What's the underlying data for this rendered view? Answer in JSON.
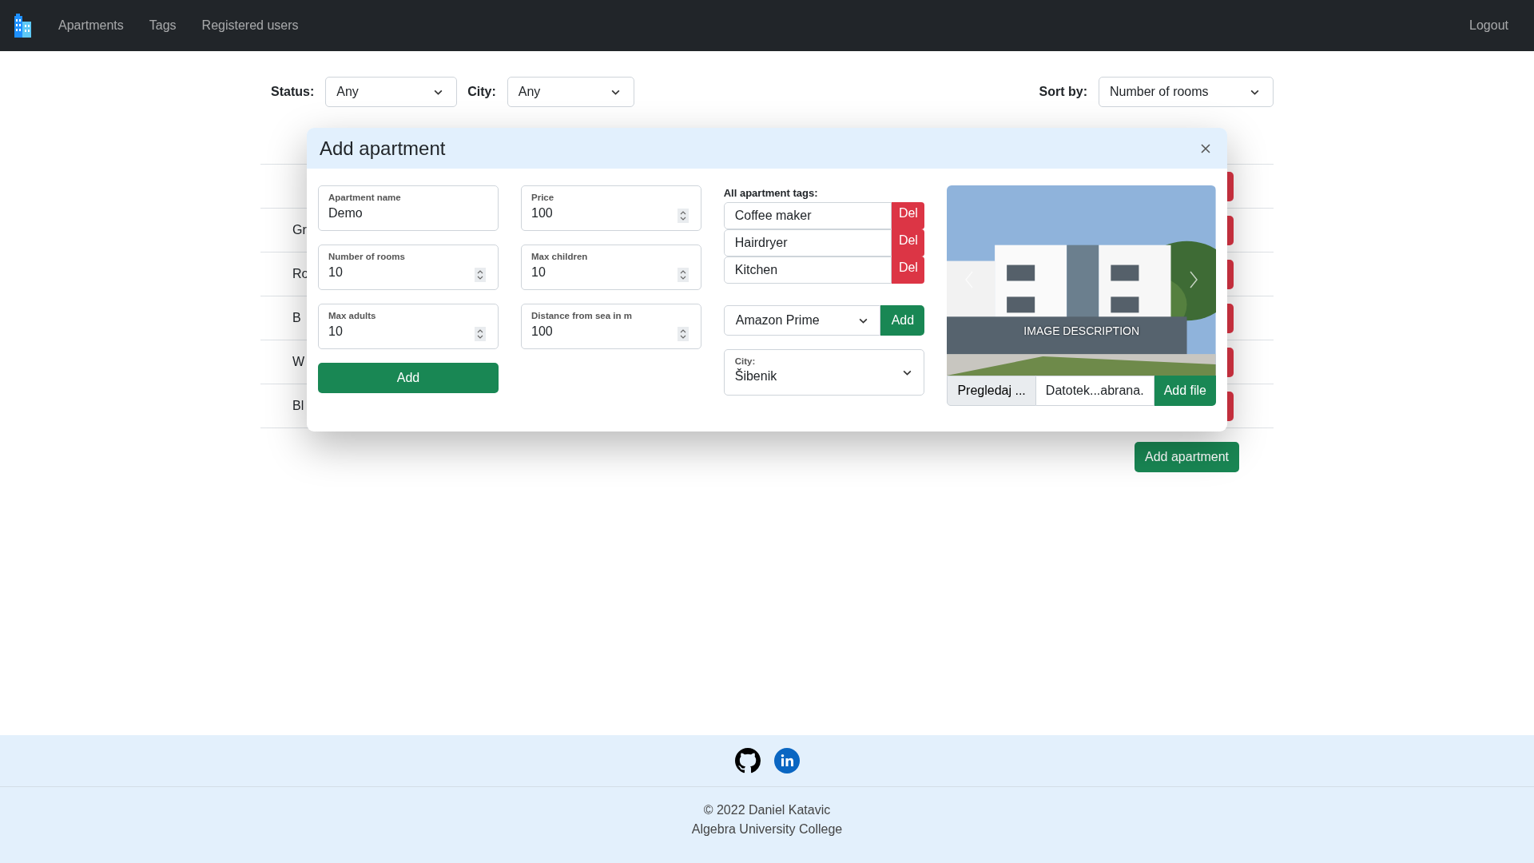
{
  "navbar": {
    "links": [
      {
        "label": "Apartments"
      },
      {
        "label": "Tags"
      },
      {
        "label": "Registered users"
      }
    ],
    "logout": "Logout"
  },
  "filters": [
    {
      "label": "Status:",
      "value": "Any"
    },
    {
      "label": "City:",
      "value": "Any"
    }
  ],
  "sort": {
    "label": "Sort by:",
    "value": "Number of rooms"
  },
  "table": {
    "rows": [
      {
        "kind": "covered"
      },
      {
        "kind": "partial",
        "name": "Gr"
      },
      {
        "kind": "partial",
        "name": "Ro"
      },
      {
        "kind": "partial",
        "name": "B"
      },
      {
        "kind": "partial",
        "name": "W"
      },
      {
        "kind": "partial",
        "name": "Bl"
      }
    ]
  },
  "add_apartment_button": "Add apartment",
  "modal": {
    "title": "Add apartment",
    "field_columns": [
      {
        "fields": [
          {
            "label": "Apartment name",
            "value": "Demo",
            "kind": "text"
          },
          {
            "label": "Number of rooms",
            "value": "10",
            "kind": "number"
          },
          {
            "label": "Max adults",
            "value": "10",
            "kind": "number"
          }
        ]
      },
      {
        "fields": [
          {
            "label": "Price",
            "value": "100",
            "kind": "number"
          },
          {
            "label": "Max children",
            "value": "10",
            "kind": "number"
          },
          {
            "label": "Distance from sea in m",
            "value": "100",
            "kind": "number"
          }
        ]
      }
    ],
    "submit": "Add",
    "tags": {
      "heading": "All apartment tags:",
      "items": [
        {
          "label": "Coffee maker",
          "action": "Del"
        },
        {
          "label": "Hairdryer",
          "action": "Del"
        },
        {
          "label": "Kitchen",
          "action": "Del"
        }
      ],
      "select": "Amazon Prime",
      "add": "Add"
    },
    "city": {
      "label": "City:",
      "value": "Šibenik"
    },
    "gallery": {
      "caption": "IMAGE DESCRIPTION",
      "browse": "Pregledaj ...",
      "file_name": "Datotek...abrana.",
      "add_file": "Add file"
    }
  },
  "footer": {
    "copyright": "© 2022 Daniel Katavic",
    "school": "Algebra University College"
  }
}
